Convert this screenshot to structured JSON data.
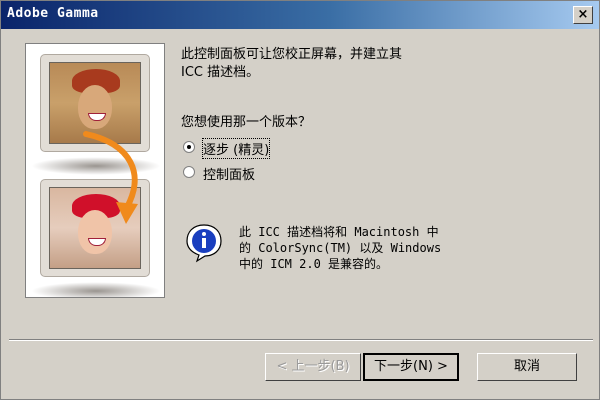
{
  "window": {
    "title": "Adobe Gamma",
    "close_glyph": "×"
  },
  "intro": {
    "line1": "此控制面板可让您校正屏幕，并建立其",
    "line2": "ICC 描述档。"
  },
  "question": "您想使用那一个版本？",
  "options": [
    {
      "label": "逐步 (精灵)",
      "selected": true
    },
    {
      "label": "控制面板",
      "selected": false
    }
  ],
  "info": {
    "icon": "info-icon",
    "line1": "此 ICC 描述档将和 Macintosh 中",
    "line2": "的 ColorSync(TM) 以及 Windows",
    "line3": "中的 ICM 2.0 是兼容的。"
  },
  "buttons": {
    "back": "< 上一步(B)",
    "next": "下一步(N) >",
    "cancel": "取消"
  },
  "colors": {
    "titlebar_start": "#0a246a",
    "titlebar_end": "#a6caf0",
    "dialog_bg": "#d4d0c8",
    "arrow": "#f08a1c"
  },
  "icons": [
    "close-icon",
    "info-icon",
    "curved-arrow-icon",
    "monitor-icon"
  ]
}
